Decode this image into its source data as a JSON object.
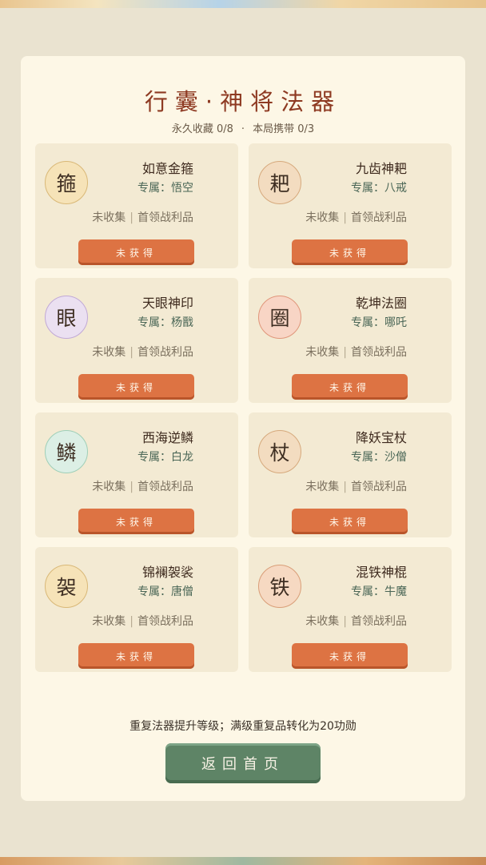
{
  "header": {
    "title": "行囊·神将法器",
    "permanent_label": "永久收藏 0/8",
    "separator": "·",
    "carry_label": "本局携带 0/3"
  },
  "items": [
    {
      "glyph": "箍",
      "name": "如意金箍",
      "owner": "专属：悟空",
      "status": "未收集",
      "source": "首领战利品",
      "button": "未获得",
      "color": "gold"
    },
    {
      "glyph": "耙",
      "name": "九齿神耙",
      "owner": "专属：八戒",
      "status": "未收集",
      "source": "首领战利品",
      "button": "未获得",
      "color": "tan"
    },
    {
      "glyph": "眼",
      "name": "天眼神印",
      "owner": "专属：杨戬",
      "status": "未收集",
      "source": "首领战利品",
      "button": "未获得",
      "color": "purple"
    },
    {
      "glyph": "圈",
      "name": "乾坤法圈",
      "owner": "专属：哪吒",
      "status": "未收集",
      "source": "首领战利品",
      "button": "未获得",
      "color": "pink"
    },
    {
      "glyph": "鳞",
      "name": "西海逆鳞",
      "owner": "专属：白龙",
      "status": "未收集",
      "source": "首领战利品",
      "button": "未获得",
      "color": "mint"
    },
    {
      "glyph": "杖",
      "name": "降妖宝杖",
      "owner": "专属：沙僧",
      "status": "未收集",
      "source": "首领战利品",
      "button": "未获得",
      "color": "tan"
    },
    {
      "glyph": "袈",
      "name": "锦襕袈裟",
      "owner": "专属：唐僧",
      "status": "未收集",
      "source": "首领战利品",
      "button": "未获得",
      "color": "gold"
    },
    {
      "glyph": "铁",
      "name": "混铁神棍",
      "owner": "专属：牛魔",
      "status": "未收集",
      "source": "首领战利品",
      "button": "未获得",
      "color": "peach"
    }
  ],
  "footer": {
    "note": "重复法器提升等级；满级重复品转化为20功勋",
    "home_button": "返回首页"
  },
  "colors": {
    "panel": "#fdf7e6",
    "title": "#8e3a22",
    "action_button": "#dd7343",
    "home_button": "#5e8466"
  }
}
